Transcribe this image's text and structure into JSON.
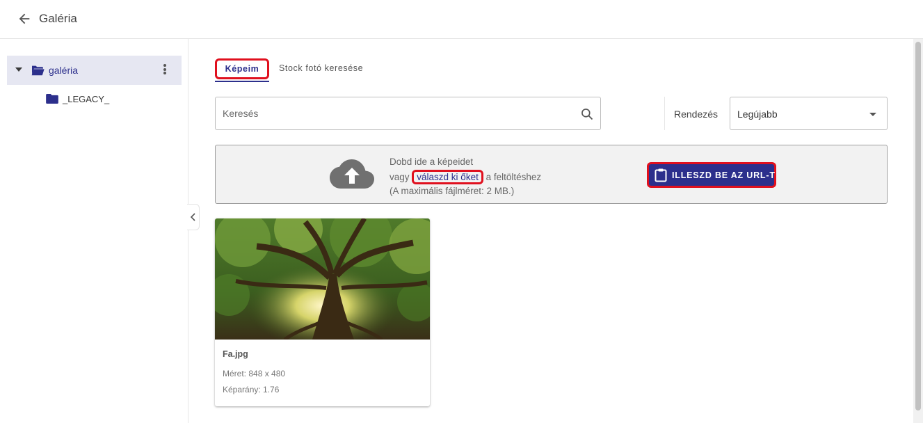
{
  "header": {
    "title": "Galéria"
  },
  "sidebar": {
    "root": {
      "label": "galéria"
    },
    "children": [
      {
        "label": "_LEGACY_"
      }
    ]
  },
  "tabs": {
    "mine": "Képeim",
    "stock": "Stock fotó keresése"
  },
  "search": {
    "placeholder": "Keresés"
  },
  "sort": {
    "label": "Rendezés",
    "value": "Legújabb"
  },
  "dropzone": {
    "line1": "Dobd ide a képeidet",
    "line2_prefix": "vagy ",
    "choose_link": "válaszd ki őket",
    "line2_suffix": " a feltöltéshez",
    "line3": "(A maximális fájlméret: 2 MB.)",
    "paste_button": "ILLESZD BE AZ URL-T"
  },
  "images": [
    {
      "name": "Fa.jpg",
      "size": "Méret: 848 x 480",
      "ratio": "Képarány: 1.76"
    }
  ],
  "colors": {
    "accent": "#2c2f8c",
    "highlight": "#e0101e"
  }
}
